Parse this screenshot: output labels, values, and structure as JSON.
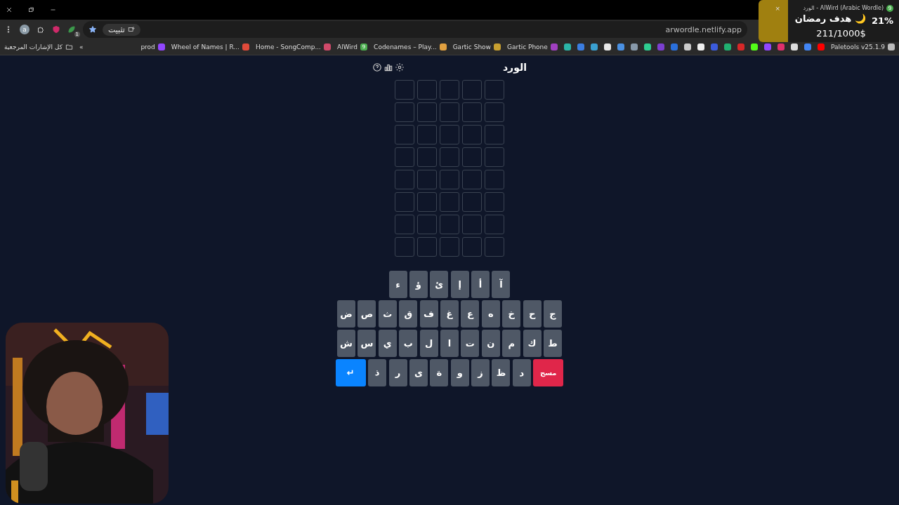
{
  "tab": {
    "title": "الورد - AlWird (Arabic Wordle)",
    "favicon": "9"
  },
  "toolbar": {
    "profile_initial": "a",
    "extension_badge": "1",
    "install_label": "تثبيت",
    "url": "arwordle.netlify.app"
  },
  "bookmarks": {
    "items": [
      {
        "label": "Paletools v25.1.9",
        "color": "#bbbbbb"
      },
      {
        "color": "#ff0000"
      },
      {
        "color": "#4285f4"
      },
      {
        "color": "#dddddd"
      },
      {
        "color": "#e1306c"
      },
      {
        "color": "#9146ff"
      },
      {
        "color": "#53fc18"
      },
      {
        "color": "#d62828"
      },
      {
        "color": "#20b070"
      },
      {
        "color": "#3b5bdb"
      },
      {
        "color": "#f0f0f0"
      },
      {
        "color": "#cccccc"
      },
      {
        "color": "#2a6fdb"
      },
      {
        "color": "#7b3fd0"
      },
      {
        "color": "#2ecc90"
      },
      {
        "color": "#8899aa"
      },
      {
        "color": "#4a90e2"
      },
      {
        "color": "#e8e8e8"
      },
      {
        "color": "#3aa0d0"
      },
      {
        "color": "#3b7de0"
      },
      {
        "color": "#2bb5a8"
      },
      {
        "label": "Gartic Phone",
        "color": "#a040c0"
      },
      {
        "label": "Gartic Show",
        "color": "#c8a030"
      },
      {
        "label": "Codenames – Play...",
        "color": "#e0a040"
      },
      {
        "label": "AlWird",
        "color": "#4caf50",
        "badge": "9"
      },
      {
        "label": "Home - SongComp...",
        "color": "#d04a6a"
      },
      {
        "label": "Wheel of Names | R...",
        "color": "#e04a3a"
      },
      {
        "label": "prod",
        "color": "#9146ff"
      }
    ],
    "overflow": "»",
    "all_bookmarks": "كل الإشارات المرجعية"
  },
  "overlay": {
    "close": "×",
    "goal_title": "هدف رمضان 🌙",
    "amount": "211/1000$",
    "percent": "21%",
    "level": 0.21
  },
  "game": {
    "title": "الورد",
    "board": {
      "rows": [
        {
          "tiles": [
            {
              "filled": false
            },
            {
              "filled": false
            },
            {
              "filled": false
            },
            {
              "filled": false
            },
            {
              "filled": false
            }
          ]
        },
        {
          "tiles": [
            {
              "filled": false
            },
            {
              "filled": false
            },
            {
              "filled": false
            },
            {
              "filled": false
            },
            {
              "filled": false
            }
          ]
        },
        {
          "tiles": [
            {
              "filled": false
            },
            {
              "filled": false
            },
            {
              "filled": false
            },
            {
              "filled": false
            },
            {
              "filled": false
            }
          ]
        },
        {
          "tiles": [
            {
              "filled": false
            },
            {
              "filled": false
            },
            {
              "filled": false
            },
            {
              "filled": false
            },
            {
              "filled": false
            }
          ]
        },
        {
          "tiles": [
            {
              "filled": false
            },
            {
              "filled": false
            },
            {
              "filled": false
            },
            {
              "filled": false
            },
            {
              "filled": false
            }
          ]
        },
        {
          "tiles": [
            {
              "filled": false
            },
            {
              "filled": false
            },
            {
              "filled": false
            },
            {
              "filled": false
            },
            {
              "filled": false
            }
          ]
        },
        {
          "tiles": [
            {
              "filled": false
            },
            {
              "filled": false
            },
            {
              "filled": false
            },
            {
              "filled": false
            },
            {
              "filled": false
            }
          ]
        },
        {
          "tiles": [
            {
              "filled": false
            },
            {
              "filled": false
            },
            {
              "filled": false
            },
            {
              "filled": false
            },
            {
              "filled": false
            }
          ]
        }
      ]
    },
    "keyboard": {
      "rows": [
        {
          "keys": [
            {
              "kind": "letter",
              "label": "آ"
            },
            {
              "kind": "letter",
              "label": "أ"
            },
            {
              "kind": "letter",
              "label": "إ"
            },
            {
              "kind": "letter",
              "label": "ئ"
            },
            {
              "kind": "letter",
              "label": "ؤ"
            },
            {
              "kind": "letter",
              "label": "ء"
            }
          ]
        },
        {
          "keys": [
            {
              "kind": "letter",
              "label": "ج"
            },
            {
              "kind": "letter",
              "label": "ح"
            },
            {
              "kind": "letter",
              "label": "خ"
            },
            {
              "kind": "letter",
              "label": "ه"
            },
            {
              "kind": "letter",
              "label": "ع"
            },
            {
              "kind": "letter",
              "label": "غ"
            },
            {
              "kind": "letter",
              "label": "ف"
            },
            {
              "kind": "letter",
              "label": "ق"
            },
            {
              "kind": "letter",
              "label": "ث"
            },
            {
              "kind": "letter",
              "label": "ص"
            },
            {
              "kind": "letter",
              "label": "ض"
            }
          ]
        },
        {
          "keys": [
            {
              "kind": "letter",
              "label": "ط"
            },
            {
              "kind": "letter",
              "label": "ك"
            },
            {
              "kind": "letter",
              "label": "م"
            },
            {
              "kind": "letter",
              "label": "ن"
            },
            {
              "kind": "letter",
              "label": "ت"
            },
            {
              "kind": "letter",
              "label": "ا"
            },
            {
              "kind": "letter",
              "label": "ل"
            },
            {
              "kind": "letter",
              "label": "ب"
            },
            {
              "kind": "letter",
              "label": "ي"
            },
            {
              "kind": "letter",
              "label": "س"
            },
            {
              "kind": "letter",
              "label": "ش"
            }
          ]
        },
        {
          "keys": [
            {
              "kind": "delete",
              "label": "مسح"
            },
            {
              "kind": "letter",
              "label": "د"
            },
            {
              "kind": "letter",
              "label": "ظ"
            },
            {
              "kind": "letter",
              "label": "ز"
            },
            {
              "kind": "letter",
              "label": "و"
            },
            {
              "kind": "letter",
              "label": "ة"
            },
            {
              "kind": "letter",
              "label": "ى"
            },
            {
              "kind": "letter",
              "label": "ر"
            },
            {
              "kind": "letter",
              "label": "ذ"
            },
            {
              "kind": "enter",
              "label": "↵"
            }
          ]
        }
      ]
    }
  }
}
